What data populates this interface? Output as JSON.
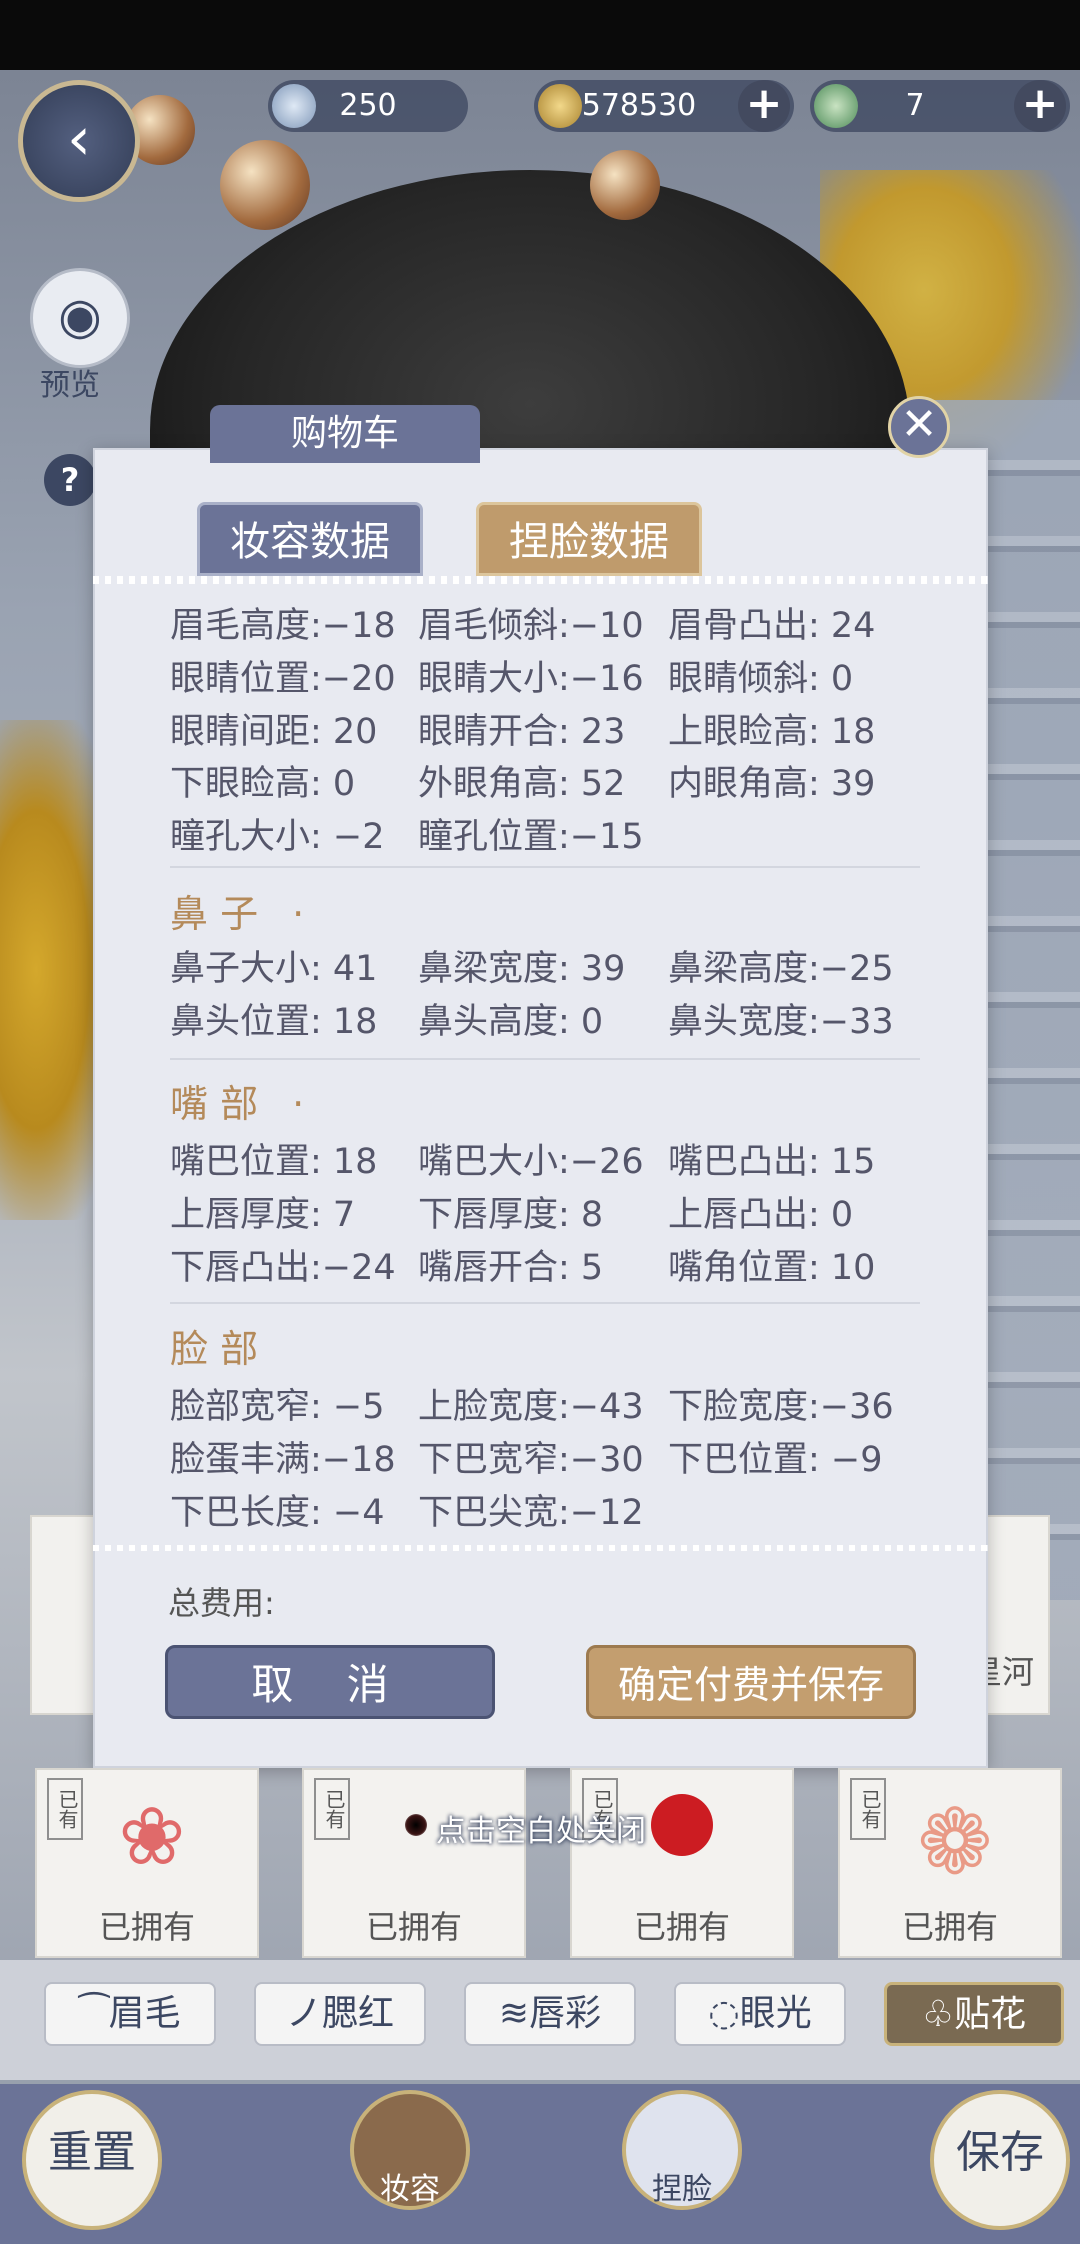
{
  "currency": {
    "jade": "250",
    "coins": "578530",
    "tickets": "7"
  },
  "sidebar": {
    "preview_label": "预览",
    "help_label": "?"
  },
  "modal": {
    "title": "购物车",
    "tabs": [
      "妆容数据",
      "捏脸数据"
    ],
    "eyes_rows": [
      [
        "眉毛高度:−18",
        "眉毛倾斜:−10",
        "眉骨凸出: 24"
      ],
      [
        "眼睛位置:−20",
        "眼睛大小:−16",
        "眼睛倾斜:  0"
      ],
      [
        "眼睛间距: 20",
        "眼睛开合: 23",
        "上眼睑高: 18"
      ],
      [
        "下眼睑高:  0",
        "外眼角高: 52",
        "内眼角高: 39"
      ],
      [
        "瞳孔大小: −2",
        "瞳孔位置:−15",
        ""
      ]
    ],
    "sections": [
      {
        "title": "鼻 子",
        "dot": "·",
        "rows": [
          [
            "鼻子大小: 41",
            "鼻梁宽度: 39",
            "鼻梁高度:−25"
          ],
          [
            "鼻头位置: 18",
            "鼻头高度:  0",
            "鼻头宽度:−33"
          ]
        ]
      },
      {
        "title": "嘴 部",
        "dot": "·",
        "rows": [
          [
            "嘴巴位置: 18",
            "嘴巴大小:−26",
            "嘴巴凸出: 15"
          ],
          [
            "上唇厚度:  7",
            "下唇厚度:  8",
            "上唇凸出:  0"
          ],
          [
            "下唇凸出:−24",
            "嘴唇开合:  5",
            "嘴角位置: 10"
          ]
        ]
      },
      {
        "title": "脸 部",
        "dot": "",
        "rows": [
          [
            "脸部宽窄: −5",
            "上脸宽度:−43",
            "下脸宽度:−36"
          ],
          [
            "脸蛋丰满:−18",
            "下巴宽窄:−30",
            "下巴位置: −9"
          ],
          [
            "下巴长度: −4",
            "下巴尖宽:−12",
            ""
          ]
        ]
      }
    ],
    "total_label": "总费用:",
    "cancel_label": "取 消",
    "confirm_label": "确定付费并保存"
  },
  "hint": "点击空白处关闭",
  "items": {
    "owned_label": "已拥有",
    "tag": "已有",
    "bg_right_text": "星河"
  },
  "categories": [
    "眉毛",
    "腮红",
    "唇彩",
    "眼光",
    "贴花"
  ],
  "bottom": {
    "reset": "重置",
    "makeup": "妆容",
    "pinch": "捏脸",
    "save": "保存"
  }
}
